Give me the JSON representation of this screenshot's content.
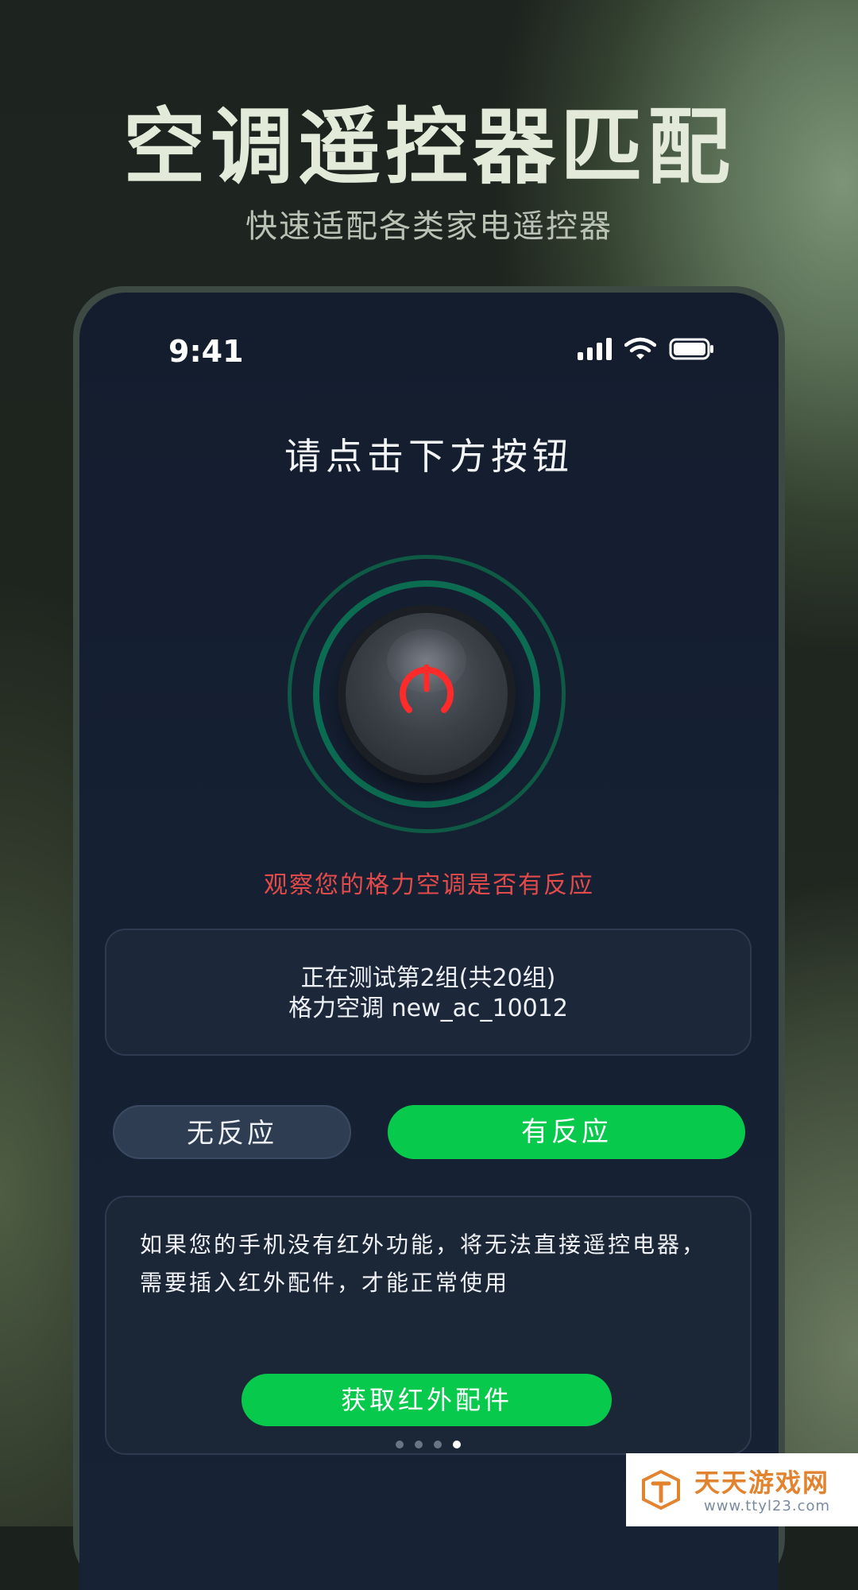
{
  "hero": {
    "title": "空调遥控器匹配",
    "subtitle": "快速适配各类家电遥控器"
  },
  "status_bar": {
    "time": "9:41",
    "icons": [
      "signal-icon",
      "wifi-icon",
      "battery-icon"
    ]
  },
  "screen": {
    "prompt": "请点击下方按钮",
    "power_button_icon": "power-icon",
    "observe_text": "观察您的格力空调是否有反应",
    "test_info": {
      "line1": "正在测试第2组(共20组)",
      "line2": "格力空调 new_ac_10012"
    },
    "buttons": {
      "no_response": "无反应",
      "has_response": "有反应"
    },
    "notice": {
      "text": "如果您的手机没有红外功能，将无法直接遥控电器，需要插入红外配件，才能正常使用",
      "button": "获取红外配件"
    },
    "pagination": {
      "total": 4,
      "active": 4
    }
  },
  "watermark": {
    "title": "天天游戏网",
    "url": "www.ttyl23.com"
  },
  "colors": {
    "accent_green": "#07c94c",
    "warning_red": "#e34b4b",
    "ring_green": "#0c6c52",
    "screen_bg": "#152033"
  }
}
